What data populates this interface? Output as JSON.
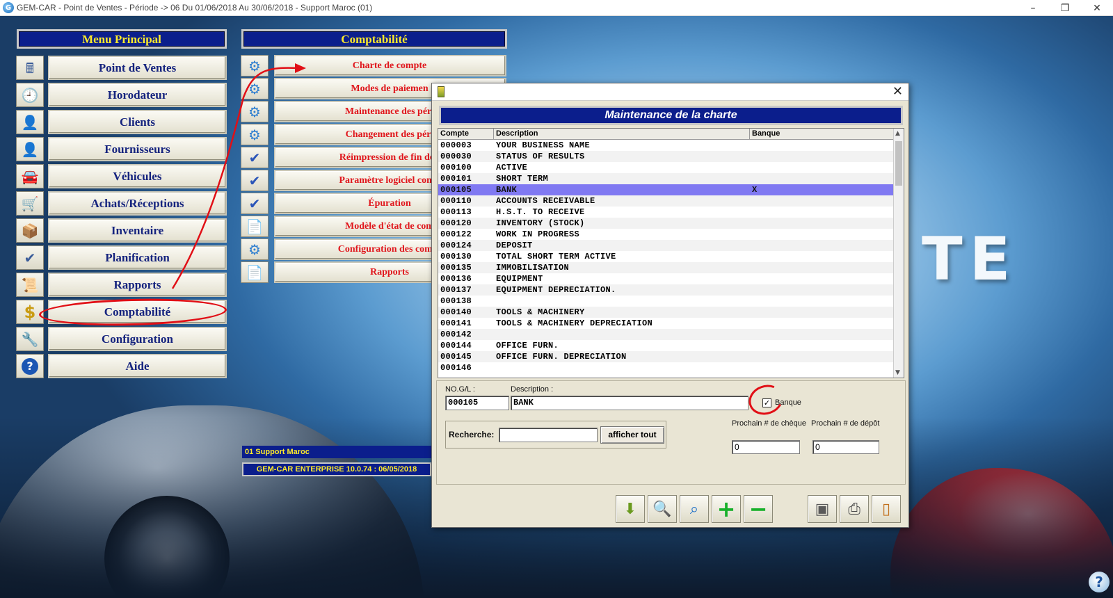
{
  "window": {
    "title": "GEM-CAR - Point de Ventes - Période -> 06 Du 01/06/2018 Au 30/06/2018 - Support Maroc (01)"
  },
  "background_logo": "TE",
  "menu_principal": {
    "title": "Menu Principal",
    "items": [
      {
        "label": "Point de Ventes",
        "icon": "cash-register-icon"
      },
      {
        "label": "Horodateur",
        "icon": "clock-icon"
      },
      {
        "label": "Clients",
        "icon": "person-icon"
      },
      {
        "label": "Fournisseurs",
        "icon": "supplier-person-icon"
      },
      {
        "label": "Véhicules",
        "icon": "car-icon"
      },
      {
        "label": "Achats/Réceptions",
        "icon": "shopping-cart-icon"
      },
      {
        "label": "Inventaire",
        "icon": "inventory-icon"
      },
      {
        "label": "Planification",
        "icon": "checkmark-pen-icon"
      },
      {
        "label": "Rapports",
        "icon": "report-scroll-icon"
      },
      {
        "label": "Comptabilité",
        "icon": "dollar-icon"
      },
      {
        "label": "Configuration",
        "icon": "tools-icon"
      },
      {
        "label": "Aide",
        "icon": "help-icon"
      }
    ]
  },
  "comptabilite_menu": {
    "title": "Comptabilité",
    "items": [
      {
        "label": "Charte de compte",
        "icon": "gear-icon"
      },
      {
        "label": "Modes de paiemen",
        "icon": "gear-icon"
      },
      {
        "label": "Maintenance des péri",
        "icon": "gear-icon"
      },
      {
        "label": "Changement des péri",
        "icon": "gear-icon"
      },
      {
        "label": "Réimpression de fin de j",
        "icon": "checkmark-icon"
      },
      {
        "label": "Paramètre logiciel comp",
        "icon": "checkmark-icon"
      },
      {
        "label": "Épuration",
        "icon": "checkmark-icon"
      },
      {
        "label": "Modèle d'état de com",
        "icon": "document-icon"
      },
      {
        "label": "Configuration des compt",
        "icon": "gear-icon"
      },
      {
        "label": "Rapports",
        "icon": "document-icon"
      }
    ]
  },
  "status": {
    "company": "01 Support Maroc",
    "version": "GEM-CAR ENTERPRISE 10.0.74 : 06/05/2018"
  },
  "dialog": {
    "title": "Maintenance de la charte",
    "columns": [
      "Compte",
      "Description",
      "Banque"
    ],
    "rows": [
      {
        "compte": "000003",
        "description": "YOUR BUSINESS NAME",
        "banque": ""
      },
      {
        "compte": "000030",
        "description": "STATUS OF RESULTS",
        "banque": ""
      },
      {
        "compte": "000100",
        "description": "ACTIVE",
        "banque": ""
      },
      {
        "compte": "000101",
        "description": "SHORT TERM",
        "banque": ""
      },
      {
        "compte": "000105",
        "description": "BANK",
        "banque": "X",
        "selected": true
      },
      {
        "compte": "000110",
        "description": "ACCOUNTS RECEIVABLE",
        "banque": ""
      },
      {
        "compte": "000113",
        "description": "H.S.T. TO RECEIVE",
        "banque": ""
      },
      {
        "compte": "000120",
        "description": "INVENTORY (STOCK)",
        "banque": ""
      },
      {
        "compte": "000122",
        "description": "WORK IN PROGRESS",
        "banque": ""
      },
      {
        "compte": "000124",
        "description": "DEPOSIT",
        "banque": ""
      },
      {
        "compte": "000130",
        "description": "TOTAL SHORT TERM ACTIVE",
        "banque": ""
      },
      {
        "compte": "000135",
        "description": "IMMOBILISATION",
        "banque": ""
      },
      {
        "compte": "000136",
        "description": "EQUIPMENT",
        "banque": ""
      },
      {
        "compte": "000137",
        "description": "EQUIPMENT DEPRECIATION.",
        "banque": ""
      },
      {
        "compte": "000138",
        "description": "",
        "banque": ""
      },
      {
        "compte": "000140",
        "description": "TOOLS & MACHINERY",
        "banque": ""
      },
      {
        "compte": "000141",
        "description": "TOOLS & MACHINERY DEPRECIATION",
        "banque": ""
      },
      {
        "compte": "000142",
        "description": "",
        "banque": ""
      },
      {
        "compte": "000144",
        "description": "OFFICE FURN.",
        "banque": ""
      },
      {
        "compte": "000145",
        "description": "OFFICE FURN. DEPRECIATION",
        "banque": ""
      },
      {
        "compte": "000146",
        "description": "",
        "banque": ""
      }
    ],
    "form": {
      "no_gl_label": "NO.G/L :",
      "no_gl_value": "000105",
      "description_label": "Description :",
      "description_value": "BANK",
      "banque_label": "Banque",
      "banque_checked": true,
      "recherche_label": "Recherche:",
      "recherche_value": "",
      "afficher_tout": "afficher tout",
      "cheque_label": "Prochain # de chèque",
      "cheque_value": "0",
      "depot_label": "Prochain # de dépôt",
      "depot_value": "0"
    },
    "toolbar": [
      "import-box-icon",
      "key-search-icon",
      "magnifier-icon",
      "add-icon",
      "remove-icon",
      "save-disk-icon",
      "printer-icon",
      "exit-door-icon"
    ]
  },
  "colors": {
    "menu_header": "#0b1e8c",
    "header_text": "#ffeb2a",
    "left_label": "#15237e",
    "right_label": "#e0161c",
    "selection": "#8079f2",
    "annotation": "#e10f16"
  }
}
